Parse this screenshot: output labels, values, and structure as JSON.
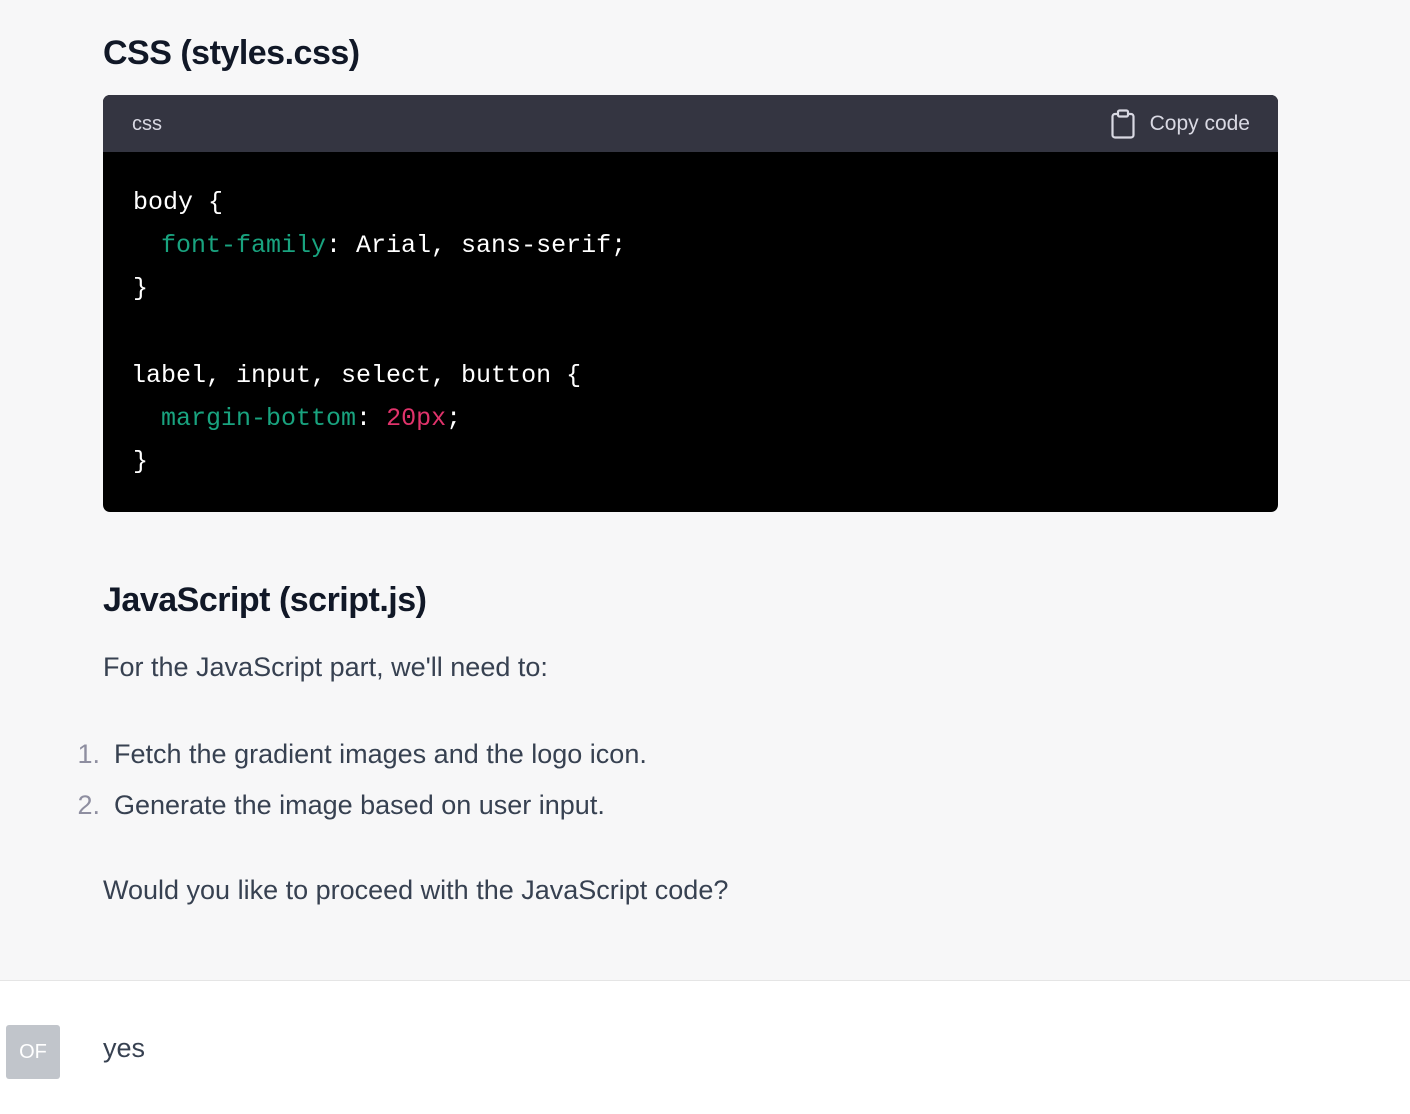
{
  "assistant": {
    "css_heading": "CSS (styles.css)",
    "code_block": {
      "language": "css",
      "copy_label": "Copy code",
      "copy_icon": "clipboard-icon",
      "lines": [
        {
          "plain": "body {"
        },
        {
          "prop": "font-family",
          "rest": ": Arial, sans-serif;"
        },
        {
          "plain": "}"
        },
        {
          "plain": ""
        },
        {
          "plain": "label, input, select, button {"
        },
        {
          "prop": "margin-bottom",
          "sep": ": ",
          "num": "20px",
          "end": ";"
        },
        {
          "plain": "}"
        }
      ]
    },
    "js_heading": "JavaScript (script.js)",
    "intro": "For the JavaScript part, we'll need to:",
    "list": [
      {
        "number": "1.",
        "text": "Fetch the gradient images and the logo icon."
      },
      {
        "number": "2.",
        "text": "Generate the image based on user input."
      }
    ],
    "question": "Would you like to proceed with the JavaScript code?"
  },
  "user": {
    "avatar_initials": "OF",
    "message": "yes"
  },
  "colors": {
    "page_bg": "#f7f7f8",
    "code_header_bg": "#343541",
    "code_bg": "#000000",
    "property": "#19a37f",
    "number": "#e0336b",
    "avatar_bg": "#c1c5cb"
  }
}
